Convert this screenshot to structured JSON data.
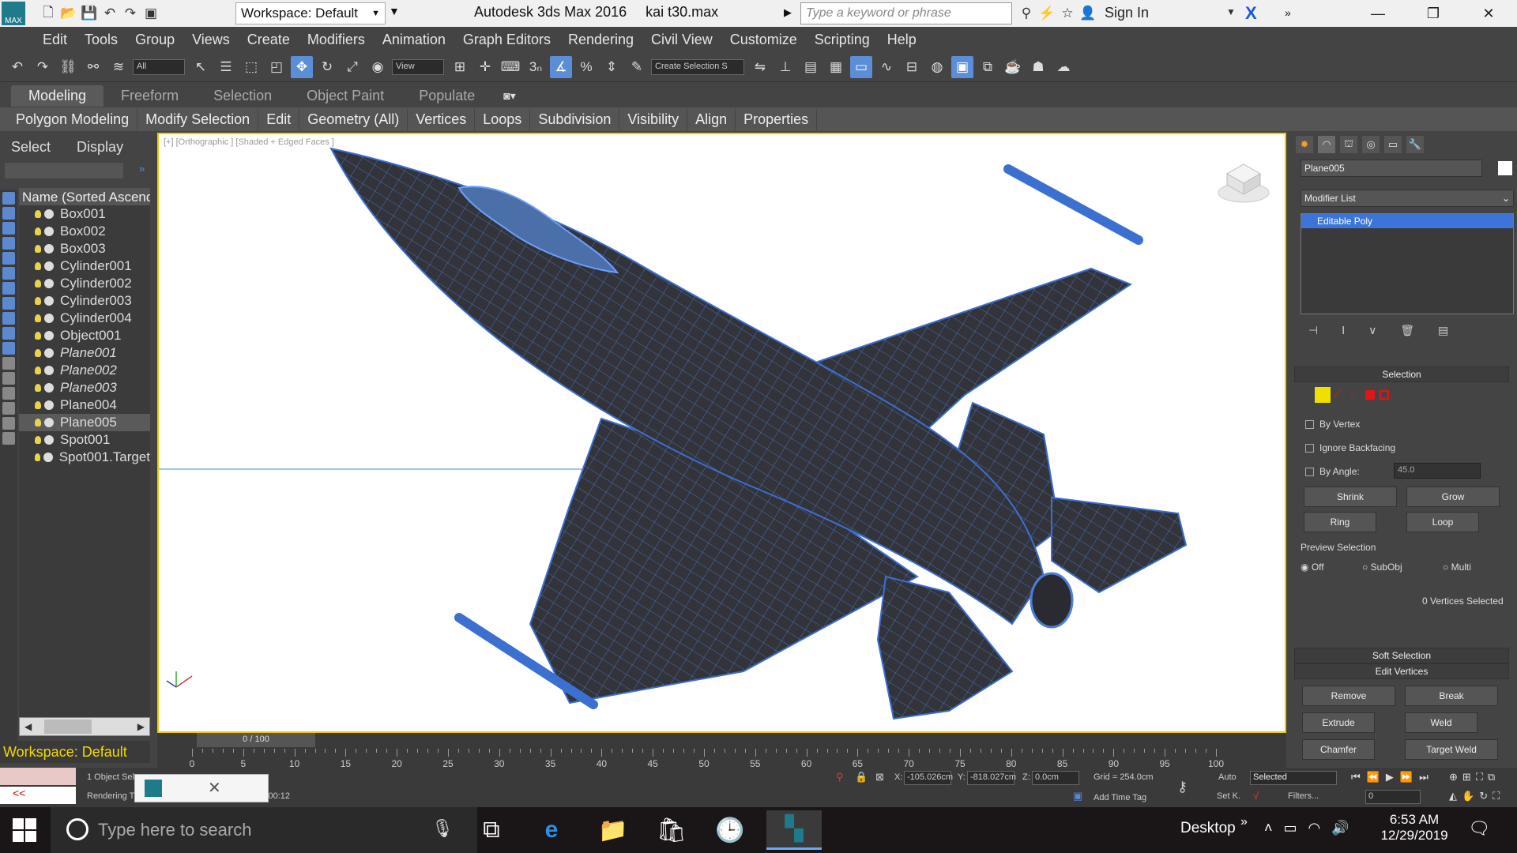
{
  "titlebar": {
    "workspace_label": "Workspace: Default",
    "app_title": "Autodesk 3ds Max 2016",
    "file_name": "kai t30.max",
    "search_placeholder": "Type a keyword or phrase",
    "sign_in": "Sign In",
    "minimize": "—",
    "restore": "❐",
    "close": "✕"
  },
  "menu": [
    "Edit",
    "Tools",
    "Group",
    "Views",
    "Create",
    "Modifiers",
    "Animation",
    "Graph Editors",
    "Rendering",
    "Civil View",
    "Customize",
    "Scripting",
    "Help"
  ],
  "toolbar": {
    "filter_value": "All",
    "refcoord_value": "View",
    "selection_set_placeholder": "Create Selection S"
  },
  "ribbon": {
    "tabs": [
      "Modeling",
      "Freeform",
      "Selection",
      "Object Paint",
      "Populate"
    ],
    "active_tab": "Modeling",
    "panels": [
      "Polygon Modeling",
      "Modify Selection",
      "Edit",
      "Geometry (All)",
      "Vertices",
      "Loops",
      "Subdivision",
      "Visibility",
      "Align",
      "Properties"
    ]
  },
  "explorer": {
    "tabs": [
      "Select",
      "Display"
    ],
    "column_header": "Name (Sorted Ascending)",
    "objects": [
      {
        "name": "Box001",
        "italic": false,
        "selected": false
      },
      {
        "name": "Box002",
        "italic": false,
        "selected": false
      },
      {
        "name": "Box003",
        "italic": false,
        "selected": false
      },
      {
        "name": "Cylinder001",
        "italic": false,
        "selected": false
      },
      {
        "name": "Cylinder002",
        "italic": false,
        "selected": false
      },
      {
        "name": "Cylinder003",
        "italic": false,
        "selected": false
      },
      {
        "name": "Cylinder004",
        "italic": false,
        "selected": false
      },
      {
        "name": "Object001",
        "italic": false,
        "selected": false
      },
      {
        "name": "Plane001",
        "italic": true,
        "selected": false
      },
      {
        "name": "Plane002",
        "italic": true,
        "selected": false
      },
      {
        "name": "Plane003",
        "italic": true,
        "selected": false
      },
      {
        "name": "Plane004",
        "italic": false,
        "selected": false
      },
      {
        "name": "Plane005",
        "italic": false,
        "selected": true
      },
      {
        "name": "Spot001",
        "italic": false,
        "selected": false
      },
      {
        "name": "Spot001.Target",
        "italic": false,
        "selected": false
      }
    ],
    "workspace_bottom": "Workspace: Default"
  },
  "viewport": {
    "label": "[+] [Orthographic ] [Shaded + Edged Faces ]",
    "mesh_color": "#3b6fd0",
    "surface_color": "#333338"
  },
  "command_panel": {
    "object_name": "Plane005",
    "modifier_list_label": "Modifier List",
    "stack_entry": "Editable Poly",
    "selection_rollout": "Selection",
    "by_vertex": "By Vertex",
    "ignore_backfacing": "Ignore Backfacing",
    "by_angle": "By Angle:",
    "angle_value": "45.0",
    "shrink": "Shrink",
    "grow": "Grow",
    "ring": "Ring",
    "loop": "Loop",
    "preview_selection": "Preview Selection",
    "preview_off": "Off",
    "preview_subobj": "SubObj",
    "preview_multi": "Multi",
    "selected_count": "0 Vertices Selected",
    "soft_selection": "Soft Selection",
    "edit_vertices": "Edit Vertices",
    "remove": "Remove",
    "break": "Break",
    "extrude": "Extrude",
    "weld": "Weld",
    "chamfer": "Chamfer",
    "target_weld": "Target Weld"
  },
  "timeline": {
    "frame_label": "0 / 100",
    "ticks": [
      0,
      5,
      10,
      15,
      20,
      25,
      30,
      35,
      40,
      45,
      50,
      55,
      60,
      65,
      70,
      75,
      80,
      85,
      90,
      95,
      100
    ]
  },
  "status": {
    "selection_info": "1 Object Sel",
    "render_info": "Rendering T",
    "render_time": "me 0:00:12",
    "x_label": "X:",
    "x_value": "-105.026cm",
    "y_label": "Y:",
    "y_value": "-818.027cm",
    "z_label": "Z:",
    "z_value": "0.0cm",
    "grid": "Grid = 254.0cm",
    "add_time_tag": "Add Time Tag",
    "auto": "Auto",
    "set_key": "Set K.",
    "selected_drop": "Selected",
    "filters": "Filters...",
    "frame_value": "0",
    "maxscript_arrow": "<<"
  },
  "taskbar": {
    "search_placeholder": "Type here to search",
    "desktop_label": "Desktop",
    "time": "6:53 AM",
    "date": "12/29/2019"
  }
}
